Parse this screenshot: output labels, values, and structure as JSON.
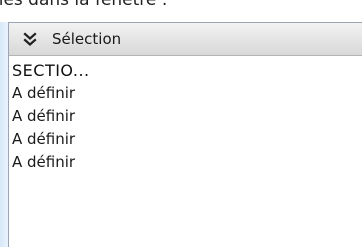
{
  "caption": "liés dans la fenêtre :",
  "panel": {
    "title": "Sélection",
    "collapse_icon": "double-chevron-down-icon",
    "items": [
      "SECTIO...",
      "A définir",
      "A définir",
      "A définir",
      "A définir"
    ]
  }
}
